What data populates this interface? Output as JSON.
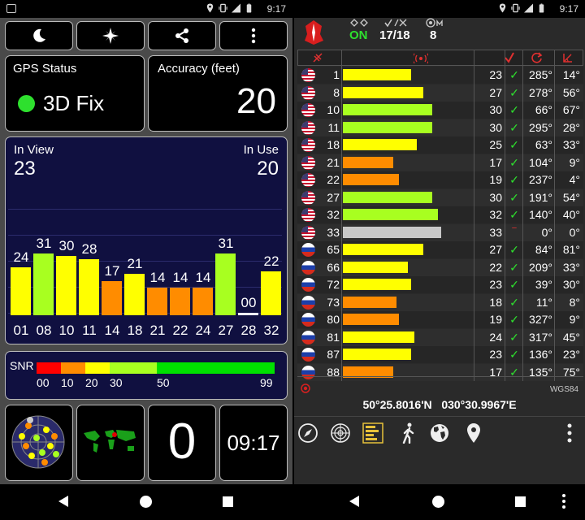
{
  "left": {
    "status_time": "9:17",
    "gps_status_label": "GPS Status",
    "gps_status_value": "3D Fix",
    "accuracy_label": "Accuracy (feet)",
    "accuracy_value": "20",
    "in_view_label": "In View",
    "in_view_value": "23",
    "in_use_label": "In Use",
    "in_use_value": "20",
    "satellites": [
      {
        "id": "01",
        "snr": 24,
        "snr_label": "24",
        "color": "#ffff00"
      },
      {
        "id": "08",
        "snr": 31,
        "snr_label": "31",
        "color": "#a8ff20"
      },
      {
        "id": "10",
        "snr": 30,
        "snr_label": "30",
        "color": "#ffff00"
      },
      {
        "id": "11",
        "snr": 28,
        "snr_label": "28",
        "color": "#ffff00"
      },
      {
        "id": "14",
        "snr": 17,
        "snr_label": "17",
        "color": "#ff8c00"
      },
      {
        "id": "18",
        "snr": 21,
        "snr_label": "21",
        "color": "#ffff00"
      },
      {
        "id": "21",
        "snr": 14,
        "snr_label": "14",
        "color": "#ff8c00"
      },
      {
        "id": "22",
        "snr": 14,
        "snr_label": "14",
        "color": "#ff8c00"
      },
      {
        "id": "24",
        "snr": 14,
        "snr_label": "14",
        "color": "#ff8c00"
      },
      {
        "id": "27",
        "snr": 31,
        "snr_label": "31",
        "color": "#a8ff20"
      },
      {
        "id": "28",
        "snr": 0,
        "snr_label": "00",
        "color": "#ffffff"
      },
      {
        "id": "32",
        "snr": 22,
        "snr_label": "22",
        "color": "#ffff00"
      }
    ],
    "snr_label": "SNR",
    "snr_scale": [
      {
        "label": "00",
        "color": "#ff0000"
      },
      {
        "label": "10",
        "color": "#ff8c00"
      },
      {
        "label": "20",
        "color": "#ffff00"
      },
      {
        "label": "30",
        "color": "#a8ff20"
      },
      {
        "label": "50",
        "color": "#00e000"
      },
      {
        "label": "99",
        "color": "#00e000"
      }
    ],
    "satellite_count_value": "0",
    "clock_value": "09:17",
    "toolbar_icons": [
      "moon-icon",
      "compass-star-icon",
      "share-icon",
      "overflow-menu-icon"
    ]
  },
  "right": {
    "status_time": "9:17",
    "gps_on_value": "ON",
    "sat_used_value": "17/18",
    "sat_range_value": "8",
    "rows": [
      {
        "prn": "1",
        "snr": 23,
        "snr_label": "23",
        "used": true,
        "azimuth": "285°",
        "elevation": "14°",
        "flag": "us",
        "color": "#ffff00"
      },
      {
        "prn": "8",
        "snr": 27,
        "snr_label": "27",
        "used": true,
        "azimuth": "278°",
        "elevation": "56°",
        "flag": "us",
        "color": "#ffff00"
      },
      {
        "prn": "10",
        "snr": 30,
        "snr_label": "30",
        "used": true,
        "azimuth": "66°",
        "elevation": "67°",
        "flag": "us",
        "color": "#a8ff20"
      },
      {
        "prn": "11",
        "snr": 30,
        "snr_label": "30",
        "used": true,
        "azimuth": "295°",
        "elevation": "28°",
        "flag": "us",
        "color": "#a8ff20"
      },
      {
        "prn": "18",
        "snr": 25,
        "snr_label": "25",
        "used": true,
        "azimuth": "63°",
        "elevation": "33°",
        "flag": "us",
        "color": "#ffff00"
      },
      {
        "prn": "21",
        "snr": 17,
        "snr_label": "17",
        "used": true,
        "azimuth": "104°",
        "elevation": "9°",
        "flag": "us",
        "color": "#ff8c00"
      },
      {
        "prn": "22",
        "snr": 19,
        "snr_label": "19",
        "used": true,
        "azimuth": "237°",
        "elevation": "4°",
        "flag": "us",
        "color": "#ff8c00"
      },
      {
        "prn": "27",
        "snr": 30,
        "snr_label": "30",
        "used": true,
        "azimuth": "191°",
        "elevation": "54°",
        "flag": "us",
        "color": "#a8ff20"
      },
      {
        "prn": "32",
        "snr": 32,
        "snr_label": "32",
        "used": true,
        "azimuth": "140°",
        "elevation": "40°",
        "flag": "us",
        "color": "#a8ff20"
      },
      {
        "prn": "33",
        "snr": 33,
        "snr_label": "33",
        "used": false,
        "azimuth": "0°",
        "elevation": "0°",
        "flag": "us",
        "color": "#c8c8c8"
      },
      {
        "prn": "65",
        "snr": 27,
        "snr_label": "27",
        "used": true,
        "azimuth": "84°",
        "elevation": "81°",
        "flag": "ru",
        "color": "#ffff00"
      },
      {
        "prn": "66",
        "snr": 22,
        "snr_label": "22",
        "used": true,
        "azimuth": "209°",
        "elevation": "33°",
        "flag": "ru",
        "color": "#ffff00"
      },
      {
        "prn": "72",
        "snr": 23,
        "snr_label": "23",
        "used": true,
        "azimuth": "39°",
        "elevation": "30°",
        "flag": "ru",
        "color": "#ffff00"
      },
      {
        "prn": "73",
        "snr": 18,
        "snr_label": "18",
        "used": true,
        "azimuth": "11°",
        "elevation": "8°",
        "flag": "ru",
        "color": "#ff8c00"
      },
      {
        "prn": "80",
        "snr": 19,
        "snr_label": "19",
        "used": true,
        "azimuth": "327°",
        "elevation": "9°",
        "flag": "ru",
        "color": "#ff8c00"
      },
      {
        "prn": "81",
        "snr": 24,
        "snr_label": "24",
        "used": true,
        "azimuth": "317°",
        "elevation": "45°",
        "flag": "ru",
        "color": "#ffff00"
      },
      {
        "prn": "87",
        "snr": 23,
        "snr_label": "23",
        "used": true,
        "azimuth": "136°",
        "elevation": "23°",
        "flag": "ru",
        "color": "#ffff00"
      },
      {
        "prn": "88",
        "snr": 17,
        "snr_label": "17",
        "used": true,
        "azimuth": "135°",
        "elevation": "75°",
        "flag": "ru",
        "color": "#ff8c00"
      }
    ],
    "datum_label": "WGS84",
    "latitude": "50°25.8016'N",
    "longitude": "030°30.9967'E",
    "bottom_icons": [
      "compass-icon",
      "radar-icon",
      "satellite-list-icon",
      "walking-icon",
      "globe-icon",
      "map-pin-icon",
      "overflow-menu-icon"
    ]
  }
}
